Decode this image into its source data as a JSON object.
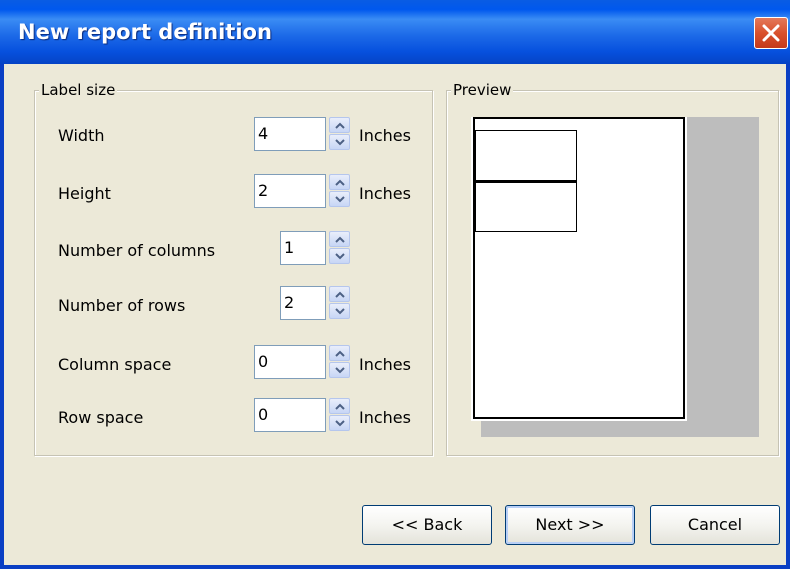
{
  "window": {
    "title": "New report definition"
  },
  "label_size": {
    "group_label": "Label size",
    "fields": [
      {
        "label": "Width",
        "value": "4",
        "unit": "Inches"
      },
      {
        "label": "Height",
        "value": "2",
        "unit": "Inches"
      },
      {
        "label": "Number of columns",
        "value": "1",
        "unit": ""
      },
      {
        "label": "Number of rows",
        "value": "2",
        "unit": ""
      },
      {
        "label": "Column space",
        "value": "0",
        "unit": "Inches"
      },
      {
        "label": "Row space",
        "value": "0",
        "unit": "Inches"
      }
    ]
  },
  "preview": {
    "group_label": "Preview"
  },
  "buttons": {
    "back": "<< Back",
    "next": "Next >>",
    "cancel": "Cancel"
  },
  "colors": {
    "titlebar": "#0058ee",
    "close": "#d9512c",
    "dialog_bg": "#ece9d8"
  }
}
